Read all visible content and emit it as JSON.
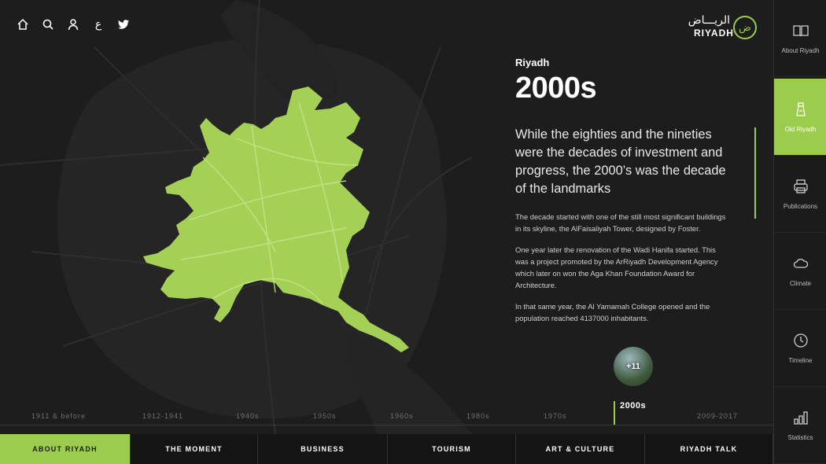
{
  "top_icons": [
    "home-icon",
    "search-icon",
    "user-icon",
    "arabic-language-toggle",
    "twitter-icon"
  ],
  "language_toggle": "ع",
  "logo": {
    "arabic": "الريـــاض",
    "english": "RIYADH",
    "mark": "ض"
  },
  "panel": {
    "city": "Riyadh",
    "decade": "2000s",
    "lead": "While the eighties and the nineties were the decades of investment and progress, the 2000’s was the decade of the landmarks",
    "paragraphs": [
      "The decade started with one of the still most significant buildings in its skyline, the AlFaisaliyah Tower, designed by Foster.",
      "One year later the renovation of the Wadi Hanifa started. This was a project promoted by the ArRiyadh Development Agency which later on won the Aga Khan Foundation Award for Architecture.",
      "In that same year, the Al Yamamah College opened and the population reached 4137000 inhabitants."
    ]
  },
  "gallery": {
    "count_label": "+11"
  },
  "timeline": [
    "1911 & before",
    "1912-1941",
    "1940s",
    "1950s",
    "1960s",
    "1980s",
    "1970s",
    "2000s",
    "2009-2017"
  ],
  "timeline_active": "2000s",
  "bottom_nav": [
    "ABOUT RIYADH",
    "THE MOMENT",
    "BUSINESS",
    "TOURISM",
    "ART & CULTURE",
    "RIYADH TALK"
  ],
  "bottom_nav_active": "ABOUT RIYADH",
  "sidebar": [
    {
      "label": "About Riyadh",
      "icon": "book-icon"
    },
    {
      "label": "Old Riyadh",
      "icon": "old-tower-icon"
    },
    {
      "label": "Publications",
      "icon": "printer-icon"
    },
    {
      "label": "Climate",
      "icon": "cloud-icon"
    },
    {
      "label": "Timeline",
      "icon": "clock-icon"
    },
    {
      "label": "Statistics",
      "icon": "bar-chart-icon"
    }
  ],
  "sidebar_active": "Old Riyadh",
  "colors": {
    "accent": "#9ccc4e",
    "background": "#1d1d1d",
    "sidebar": "#1b1b1b"
  }
}
